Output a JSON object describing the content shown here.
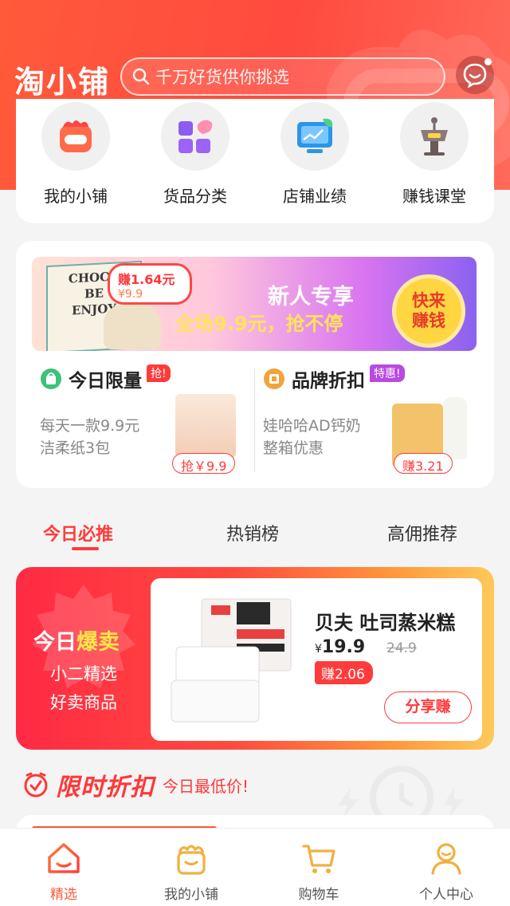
{
  "header": {
    "logo": "淘小铺",
    "search_placeholder": "千万好货供你挑选"
  },
  "quick_nav": [
    {
      "label": "我的小铺",
      "icon": "shop-mascot-icon"
    },
    {
      "label": "货品分类",
      "icon": "category-grid-icon"
    },
    {
      "label": "店铺业绩",
      "icon": "performance-screen-icon"
    },
    {
      "label": "赚钱课堂",
      "icon": "lectern-icon"
    }
  ],
  "banner": {
    "earn": "赚1.64元",
    "price": "¥9.9",
    "box_text": [
      "CHOCO",
      "BE",
      "ENJOY"
    ],
    "title": "新人专享",
    "subtitle": "全场9.9元，抢不停",
    "cta_line1": "快来",
    "cta_line2": "赚钱"
  },
  "deals": [
    {
      "title": "今日限量",
      "tag": "抢!",
      "desc_line1": "每天一款9.9元",
      "desc_line2": "洁柔纸3包",
      "pill": "抢￥9.9",
      "tag_color": "#ff3b3b"
    },
    {
      "title": "品牌折扣",
      "tag": "特惠!",
      "desc_line1": "娃哈哈AD钙奶",
      "desc_line2": "整箱优惠",
      "pill": "赚3.21",
      "tag_color": "#b84ae0"
    }
  ],
  "tabs": [
    "今日必推",
    "热销榜",
    "高佣推荐"
  ],
  "hot": {
    "title_plain": "今日",
    "title_highlight": "爆卖",
    "sub_line1": "小二精选",
    "sub_line2": "好卖商品",
    "product": {
      "name": "贝夫 吐司蒸米糕",
      "currency": "¥",
      "price": "19.9",
      "original_price": "24.9",
      "earn": "赚2.06",
      "share": "分享赚"
    }
  },
  "flash": {
    "title": "限时折扣",
    "subtitle": "今日最低价!"
  },
  "tabbar": [
    {
      "label": "精选",
      "icon": "home-icon",
      "active": true
    },
    {
      "label": "我的小铺",
      "icon": "shop-icon",
      "active": false
    },
    {
      "label": "购物车",
      "icon": "cart-icon",
      "active": false
    },
    {
      "label": "个人中心",
      "icon": "profile-icon",
      "active": false
    }
  ],
  "colors": {
    "accent": "#ff3b3b",
    "header": "#ff5a3a"
  }
}
